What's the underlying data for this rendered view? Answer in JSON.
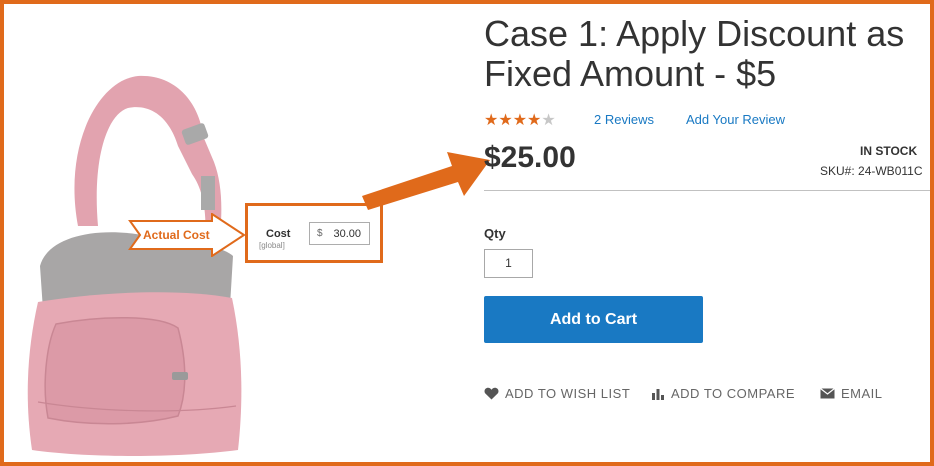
{
  "callout": {
    "label": "Actual Cost"
  },
  "cost_box": {
    "label": "Cost",
    "scope": "[global]",
    "currency": "$",
    "value": "30.00"
  },
  "product": {
    "title": "Case 1: Apply Discount as Fixed Amount - $5",
    "rating": {
      "filled": 4,
      "total": 5
    },
    "reviews_link": "2  Reviews",
    "add_review_link": "Add Your Review",
    "price": "$25.00",
    "stock_status": "IN STOCK",
    "sku": "SKU#:  24-WB011C",
    "qty_label": "Qty",
    "qty_value": "1",
    "add_to_cart_label": "Add to Cart"
  },
  "actions": {
    "wish_list": "ADD TO WISH LIST",
    "compare": "ADD TO COMPARE",
    "email": "EMAIL"
  },
  "colors": {
    "accent_orange": "#e06a1b",
    "primary_blue": "#1979c3",
    "bag_pink": "#e6a9b4"
  },
  "icons": {
    "wish": "heart-icon",
    "compare": "bar-chart-icon",
    "email": "envelope-icon"
  }
}
